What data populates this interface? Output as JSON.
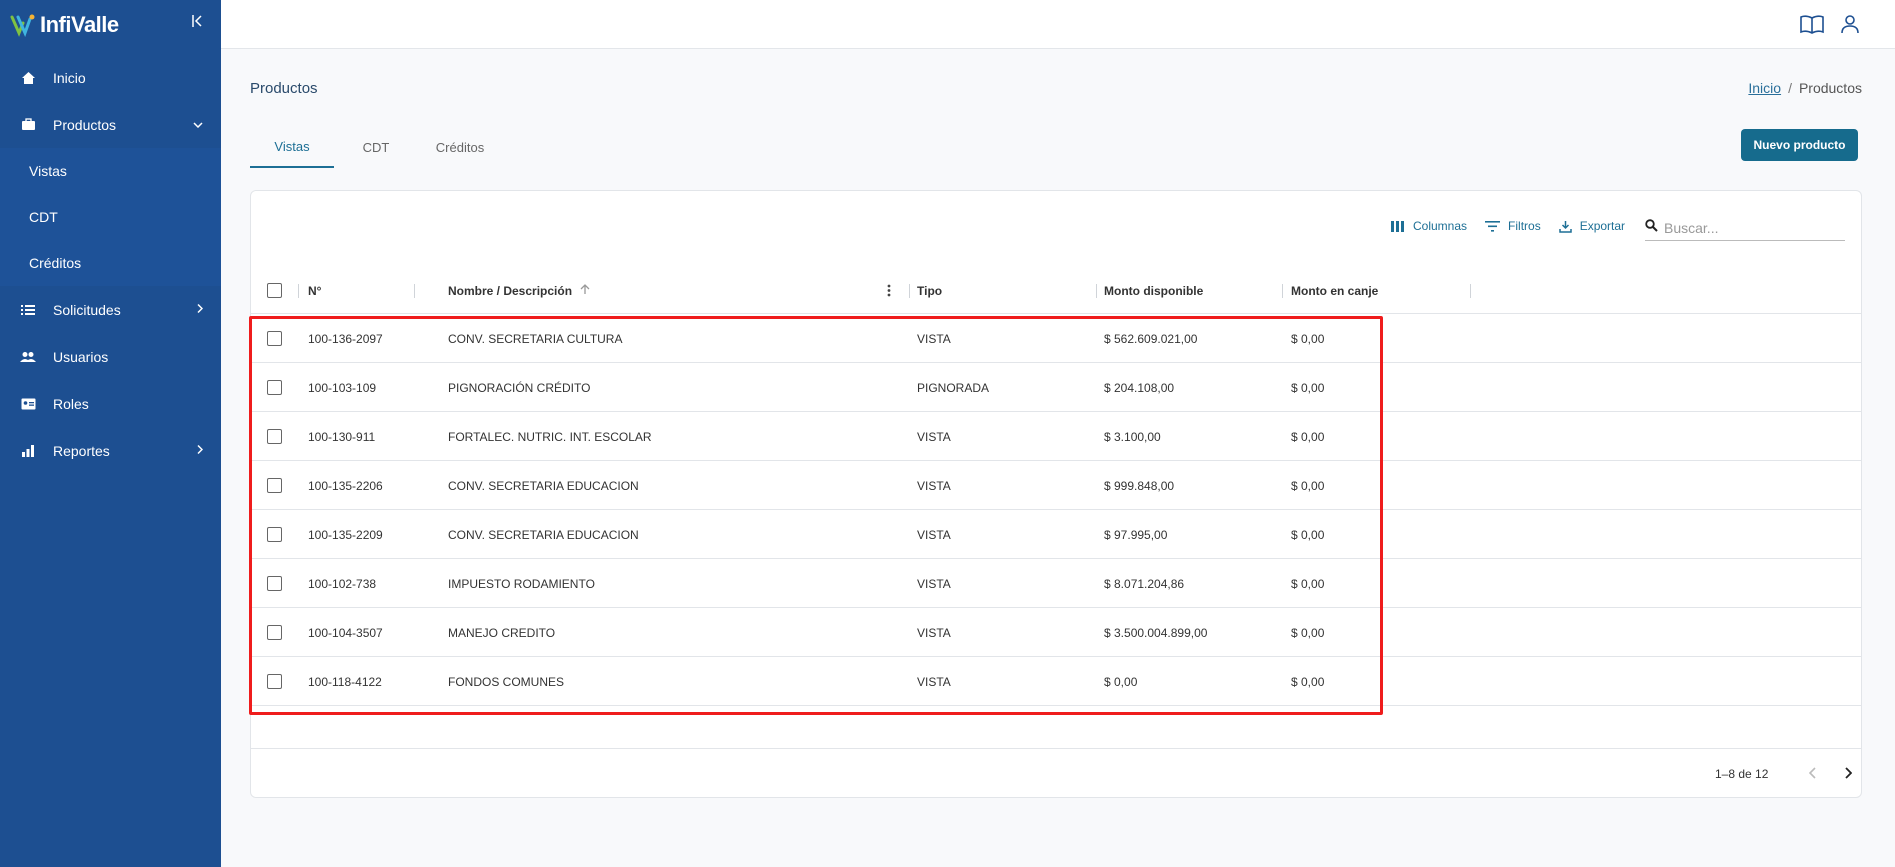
{
  "app": {
    "logo_text": "InfiValle",
    "brand_color": "#1d4f91",
    "accent_color": "#166b8d"
  },
  "sidebar": {
    "items": [
      {
        "label": "Inicio",
        "icon": "home-icon"
      },
      {
        "label": "Productos",
        "icon": "briefcase-icon",
        "expanded": true,
        "children": [
          "Vistas",
          "CDT",
          "Créditos"
        ]
      },
      {
        "label": "Solicitudes",
        "icon": "list-icon"
      },
      {
        "label": "Usuarios",
        "icon": "users-icon"
      },
      {
        "label": "Roles",
        "icon": "id-card-icon"
      },
      {
        "label": "Reportes",
        "icon": "chart-icon"
      }
    ]
  },
  "header": {
    "title": "Productos",
    "breadcrumb": {
      "home": "Inicio",
      "current": "Productos"
    }
  },
  "tabs": [
    {
      "label": "Vistas",
      "active": true
    },
    {
      "label": "CDT"
    },
    {
      "label": "Créditos"
    }
  ],
  "actions": {
    "new_product": "Nuevo producto"
  },
  "toolbar": {
    "columns": "Columnas",
    "filters": "Filtros",
    "export": "Exportar",
    "search_placeholder": "Buscar..."
  },
  "table": {
    "columns": [
      "N°",
      "Nombre / Descripción",
      "Tipo",
      "Monto disponible",
      "Monto en canje"
    ],
    "rows": [
      {
        "num": "100-136-2097",
        "name": "CONV. SECRETARIA CULTURA",
        "type": "VISTA",
        "available": "$ 562.609.021,00",
        "exchange": "$ 0,00"
      },
      {
        "num": "100-103-109",
        "name": "PIGNORACIÓN CRÉDITO",
        "type": "PIGNORADA",
        "available": "$ 204.108,00",
        "exchange": "$ 0,00"
      },
      {
        "num": "100-130-911",
        "name": "FORTALEC. NUTRIC. INT. ESCOLAR",
        "type": "VISTA",
        "available": "$ 3.100,00",
        "exchange": "$ 0,00"
      },
      {
        "num": "100-135-2206",
        "name": "CONV. SECRETARIA EDUCACION",
        "type": "VISTA",
        "available": "$ 999.848,00",
        "exchange": "$ 0,00"
      },
      {
        "num": "100-135-2209",
        "name": "CONV. SECRETARIA EDUCACION",
        "type": "VISTA",
        "available": "$ 97.995,00",
        "exchange": "$ 0,00"
      },
      {
        "num": "100-102-738",
        "name": "IMPUESTO RODAMIENTO",
        "type": "VISTA",
        "available": "$ 8.071.204,86",
        "exchange": "$ 0,00"
      },
      {
        "num": "100-104-3507",
        "name": "MANEJO CREDITO",
        "type": "VISTA",
        "available": "$ 3.500.004.899,00",
        "exchange": "$ 0,00"
      },
      {
        "num": "100-118-4122",
        "name": "FONDOS COMUNES",
        "type": "VISTA",
        "available": "$ 0,00",
        "exchange": "$ 0,00"
      }
    ]
  },
  "pagination": {
    "text": "1–8 de 12"
  }
}
